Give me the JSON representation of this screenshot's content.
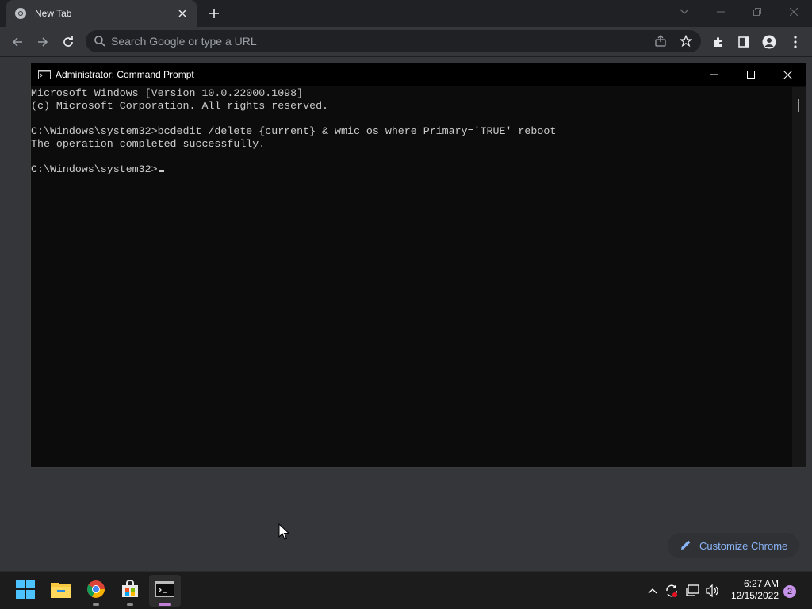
{
  "browser": {
    "tab_title": "New Tab",
    "omnibox_placeholder": "Search Google or type a URL",
    "customize_label": "Customize Chrome"
  },
  "console": {
    "title": "Administrator: Command Prompt",
    "lines": [
      "Microsoft Windows [Version 10.0.22000.1098]",
      "(c) Microsoft Corporation. All rights reserved.",
      "",
      "C:\\Windows\\system32>bcdedit /delete {current} & wmic os where Primary='TRUE' reboot",
      "The operation completed successfully.",
      "",
      "C:\\Windows\\system32>"
    ]
  },
  "taskbar": {
    "time": "6:27 AM",
    "date": "12/15/2022",
    "notification_count": "2",
    "apps": [
      "start-icon",
      "file-explorer-icon",
      "chrome-icon",
      "microsoft-store-icon",
      "command-prompt-icon"
    ]
  },
  "colors": {
    "accent": "#8ab4f8",
    "console_bg": "#0c0c0c",
    "console_text": "#cccccc",
    "taskbar_active": "#c17fd6"
  }
}
